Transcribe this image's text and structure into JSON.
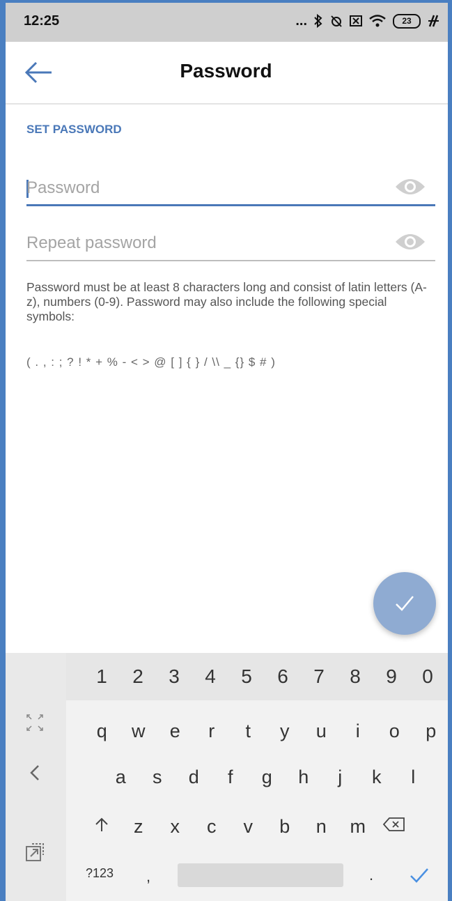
{
  "status_bar": {
    "time": "12:25",
    "icons": [
      "more-dots-icon",
      "bluetooth-icon",
      "alarm-off-icon",
      "sim-off-icon",
      "wifi-icon",
      "battery-icon",
      "charging-icon"
    ],
    "dots": "...",
    "battery_level": "23"
  },
  "app_bar": {
    "back_icon": "arrow-left-icon",
    "title": "Password"
  },
  "form": {
    "section_label": "SET PASSWORD",
    "password_placeholder": "Password",
    "repeat_placeholder": "Repeat password",
    "visibility_icon": "eye-icon",
    "hint": "Password must be at least 8 characters long and consist of latin letters (A-z), numbers (0-9). Password may also include the following special symbols:",
    "symbols": "( . , : ; ? ! * + % - < > @ [ ] { } / \\\\ _ {} $ # )"
  },
  "fab": {
    "icon": "check-icon"
  },
  "keyboard": {
    "number_row": [
      "1",
      "2",
      "3",
      "4",
      "5",
      "6",
      "7",
      "8",
      "9",
      "0"
    ],
    "row1": [
      "q",
      "w",
      "e",
      "r",
      "t",
      "y",
      "u",
      "i",
      "o",
      "p"
    ],
    "row2": [
      "a",
      "s",
      "d",
      "f",
      "g",
      "h",
      "j",
      "k",
      "l"
    ],
    "row3": [
      "z",
      "x",
      "c",
      "v",
      "b",
      "n",
      "m"
    ],
    "shift_icon": "shift-up-arrow-icon",
    "backspace_icon": "backspace-icon",
    "symbols_key": "?123",
    "comma_key": ",",
    "period_key": ".",
    "enter_icon": "check-icon",
    "side_icons": [
      "resize-icon",
      "collapse-left-icon",
      "clipboard-icon"
    ],
    "accent_color": "#4a90e2"
  },
  "colors": {
    "accent": "#4a78b8",
    "fab": "#8fabd2",
    "status_bar": "#cfcfcf"
  }
}
